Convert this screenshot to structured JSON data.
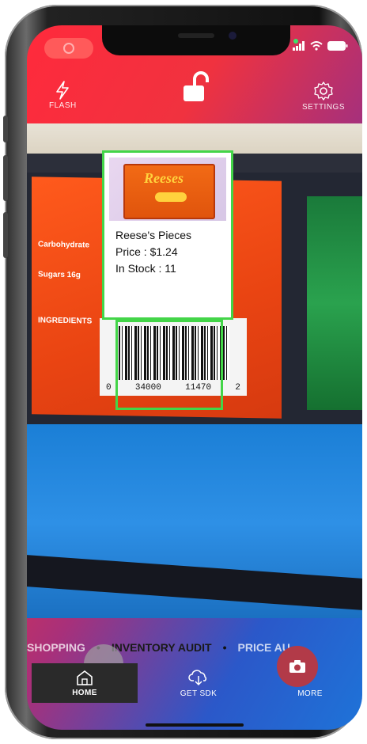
{
  "top_bar": {
    "flash_label": "FLASH",
    "settings_label": "SETTINGS"
  },
  "overlay": {
    "product_name": "Reese's Pieces",
    "price": "Price : $1.24",
    "stock": "In Stock : 11",
    "pack_brand": "Reeses"
  },
  "barcode": {
    "digits_left": "0",
    "digits_mid1": "34000",
    "digits_mid2": "11470",
    "digits_right": "2"
  },
  "modes": {
    "items": [
      "SHOPPING",
      "INVENTORY AUDIT",
      "PRICE AU"
    ],
    "separator": "•",
    "active_index": 1
  },
  "bottom_nav": {
    "home_label": "HOME",
    "get_sdk_label": "GET SDK",
    "more_label": "MORE"
  },
  "colors": {
    "detection_outline": "#43d548",
    "home_tab_bg": "#2a2a2a",
    "camera_button": "#b23a48"
  },
  "icons": [
    "flash-icon",
    "unlock-icon",
    "settings-gear-icon",
    "home-icon",
    "download-cloud-icon",
    "camera-icon",
    "signal-icon",
    "wifi-icon",
    "battery-icon"
  ]
}
